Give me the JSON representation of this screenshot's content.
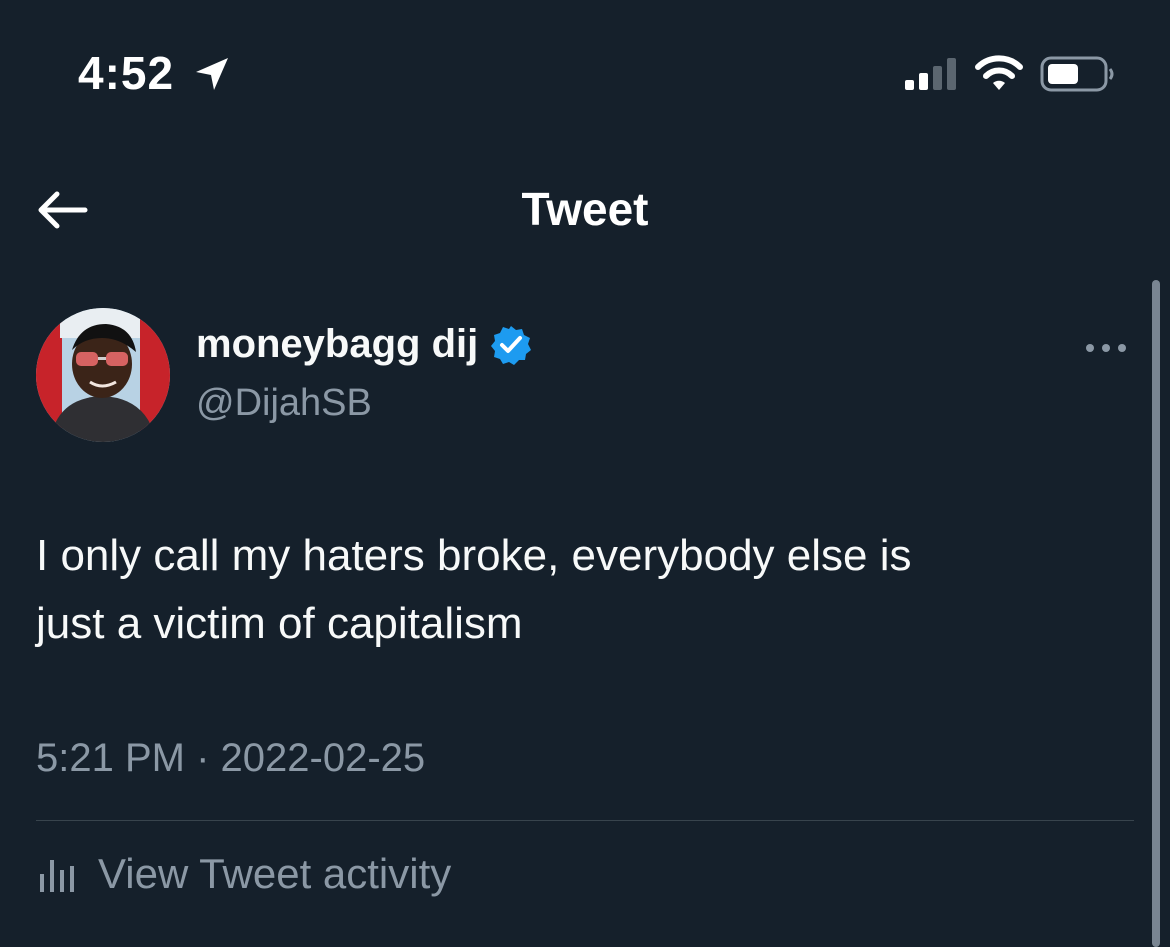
{
  "status_bar": {
    "time": "4:52"
  },
  "header": {
    "title": "Tweet"
  },
  "tweet": {
    "author_name": "moneybagg dij",
    "author_handle": "@DijahSB",
    "text_line1": "I only call my haters broke, everybody else is",
    "text_line2": "just a victim of capitalism",
    "time": "5:21 PM",
    "separator": "·",
    "date": "2022-02-25",
    "verified": true
  },
  "activity": {
    "label": "View Tweet activity"
  },
  "colors": {
    "background": "#15202b",
    "text_primary": "#f7f9f9",
    "text_secondary": "#8b98a5",
    "verified_blue": "#1d9bf0",
    "divider": "#38444d"
  },
  "icons": {
    "location": "location-arrow-icon",
    "signal": "cellular-signal-icon",
    "wifi": "wifi-icon",
    "battery": "battery-icon",
    "back": "back-arrow-icon",
    "verified": "verified-badge-icon",
    "more": "more-options-icon",
    "activity": "bar-chart-icon"
  }
}
